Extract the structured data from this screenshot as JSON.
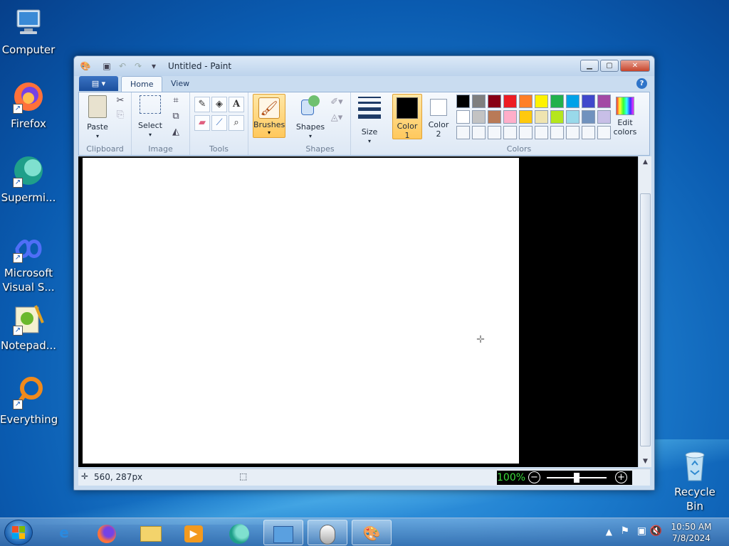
{
  "desktop": {
    "icons": [
      {
        "label": "Computer",
        "icon": "computer-icon"
      },
      {
        "label": "Firefox",
        "icon": "firefox-icon"
      },
      {
        "label": "Supermi...",
        "icon": "supermium-icon"
      },
      {
        "label": "Microsoft Visual S...",
        "icon": "visual-studio-icon"
      },
      {
        "label": "Notepad...",
        "icon": "notepad-plus-plus-icon"
      },
      {
        "label": "Everything",
        "icon": "everything-icon"
      },
      {
        "label": "Recycle Bin",
        "icon": "recycle-bin-icon"
      }
    ]
  },
  "window": {
    "title": "Untitled - Paint",
    "tabs": {
      "home": "Home",
      "view": "View"
    },
    "groups": {
      "clipboard": "Clipboard",
      "image": "Image",
      "tools": "Tools",
      "shapes": "Shapes",
      "colors": "Colors"
    },
    "buttons": {
      "paste": "Paste",
      "select": "Select",
      "brushes": "Brushes",
      "shapes": "Shapes",
      "size": "Size",
      "color1_a": "Color",
      "color1_b": "1",
      "color2_a": "Color",
      "color2_b": "2",
      "edit_colors_a": "Edit",
      "edit_colors_b": "colors"
    },
    "colors": {
      "color1": "#000000",
      "color2": "#ffffff",
      "palette_row1": [
        "#000000",
        "#7f7f7f",
        "#880015",
        "#ed1c24",
        "#ff7f27",
        "#fff200",
        "#22b14c",
        "#00a2e8",
        "#3f48cc",
        "#a349a4"
      ],
      "palette_row2": [
        "#ffffff",
        "#c3c3c3",
        "#b97a57",
        "#ffaec9",
        "#ffc90e",
        "#efe4b0",
        "#b5e61d",
        "#99d9ea",
        "#7092be",
        "#c8bfe7"
      ]
    },
    "status": {
      "position": "560, 287px",
      "zoom": "100%"
    }
  },
  "taskbar": {
    "time": "10:50 AM",
    "date": "7/8/2024"
  }
}
